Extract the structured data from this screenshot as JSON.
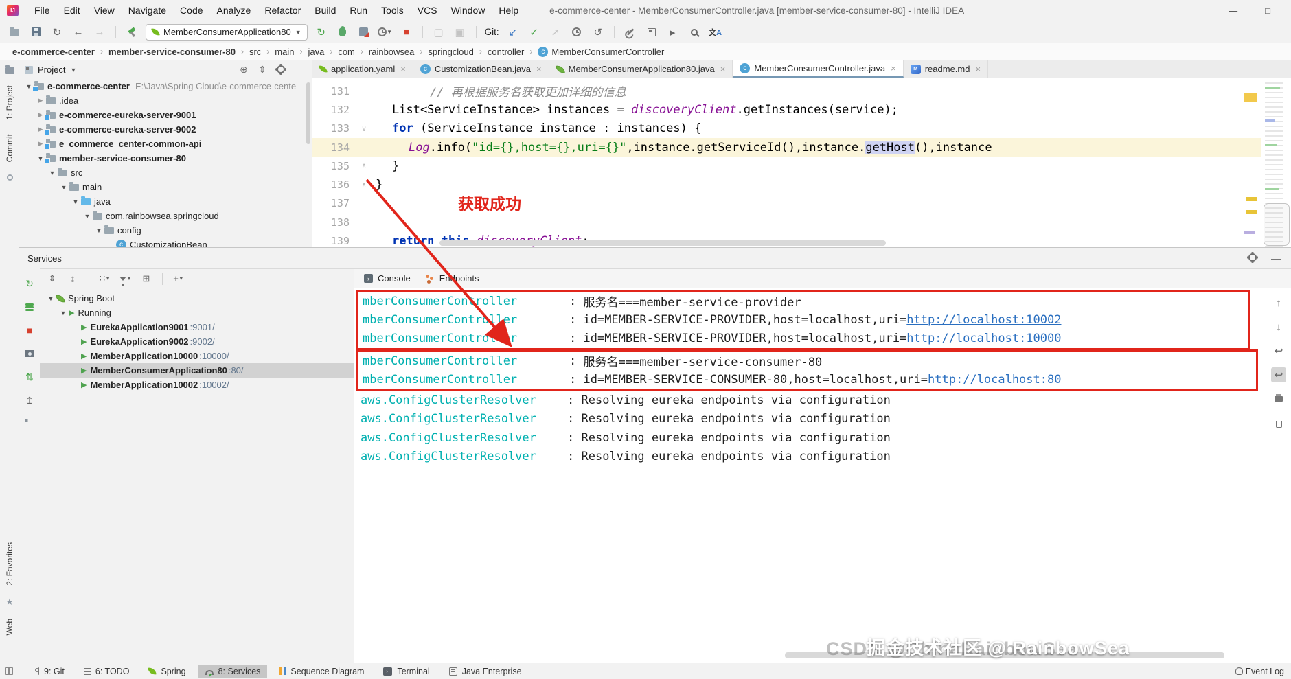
{
  "window": {
    "title": "e-commerce-center - MemberConsumerController.java [member-service-consumer-80] - IntelliJ IDEA",
    "minimize": "—",
    "maximize": "□",
    "logo": "IJ"
  },
  "menus": [
    "File",
    "Edit",
    "View",
    "Navigate",
    "Code",
    "Analyze",
    "Refactor",
    "Build",
    "Run",
    "Tools",
    "VCS",
    "Window",
    "Help"
  ],
  "toolbar": {
    "run_config": "MemberConsumerApplication80",
    "git_label": "Git:",
    "translate_cn": "文",
    "translate_en": "A"
  },
  "breadcrumbs": [
    {
      "label": "e-commerce-center",
      "bold": true
    },
    {
      "label": "member-service-consumer-80",
      "bold": true
    },
    {
      "label": "src"
    },
    {
      "label": "main"
    },
    {
      "label": "java"
    },
    {
      "label": "com"
    },
    {
      "label": "rainbowsea"
    },
    {
      "label": "springcloud"
    },
    {
      "label": "controller"
    },
    {
      "label": "MemberConsumerController",
      "icon": "class"
    }
  ],
  "left_stripe": {
    "top_items": [
      "1: Project",
      "Commit"
    ],
    "bottom_items": [
      "2: Favorites",
      "Web"
    ]
  },
  "project_panel": {
    "title": "Project",
    "tree": [
      {
        "label": "e-commerce-center",
        "path": "E:\\Java\\Spring Cloud\\e-commerce-cente",
        "indent": 0,
        "arrow": "exp",
        "icon": "module",
        "bold": true
      },
      {
        "label": ".idea",
        "indent": 1,
        "arrow": "col",
        "icon": "folder"
      },
      {
        "label": "e-commerce-eureka-server-9001",
        "indent": 1,
        "arrow": "col",
        "icon": "module",
        "bold": true
      },
      {
        "label": "e-commerce-eureka-server-9002",
        "indent": 1,
        "arrow": "col",
        "icon": "module",
        "bold": true
      },
      {
        "label": "e_commerce_center-common-api",
        "indent": 1,
        "arrow": "col",
        "icon": "module",
        "bold": true
      },
      {
        "label": "member-service-consumer-80",
        "indent": 1,
        "arrow": "exp",
        "icon": "module",
        "bold": true
      },
      {
        "label": "src",
        "indent": 2,
        "arrow": "exp",
        "icon": "folder"
      },
      {
        "label": "main",
        "indent": 3,
        "arrow": "exp",
        "icon": "folder"
      },
      {
        "label": "java",
        "indent": 4,
        "arrow": "exp",
        "icon": "folder-blue"
      },
      {
        "label": "com.rainbowsea.springcloud",
        "indent": 5,
        "arrow": "exp",
        "icon": "folder"
      },
      {
        "label": "config",
        "indent": 6,
        "arrow": "exp",
        "icon": "folder"
      },
      {
        "label": "CustomizationBean",
        "indent": 7,
        "arrow": "none",
        "icon": "class"
      }
    ]
  },
  "editor": {
    "tabs": [
      {
        "label": "application.yaml",
        "icon": "leaf",
        "close": "×"
      },
      {
        "label": "CustomizationBean.java",
        "icon": "class",
        "close": "×"
      },
      {
        "label": "MemberConsumerApplication80.java",
        "icon": "springboot",
        "close": "×"
      },
      {
        "label": "MemberConsumerController.java",
        "icon": "class",
        "close": "×",
        "active": true
      },
      {
        "label": "readme.md",
        "icon": "md",
        "close": "×"
      }
    ],
    "annotation": "获取成功",
    "lines": [
      {
        "num": "131",
        "indent": 79,
        "fold": "",
        "tokens": [
          [
            "cmt",
            "// 再根据服务名获取更加详细的信息"
          ]
        ]
      },
      {
        "num": "132",
        "indent": 24,
        "fold": "",
        "tokens": [
          [
            "pln",
            "List<ServiceInstance> instances = "
          ],
          [
            "fld",
            "discoveryClient"
          ],
          [
            "pln",
            ".getInstances(service);"
          ]
        ]
      },
      {
        "num": "133",
        "indent": 24,
        "fold": "down",
        "tokens": [
          [
            "kw",
            "for"
          ],
          [
            "pln",
            " (ServiceInstance instance : instances) {"
          ]
        ]
      },
      {
        "num": "134",
        "indent": 48,
        "fold": "",
        "highlight": true,
        "tokens": [
          [
            "fld",
            "Log"
          ],
          [
            "pln",
            ".info("
          ],
          [
            "str",
            "\"id={},host={},uri={}\""
          ],
          [
            "pln",
            ",instance.getServiceId(),instance."
          ],
          [
            "sel",
            "getHost"
          ],
          [
            "pln",
            "(),instance"
          ]
        ]
      },
      {
        "num": "135",
        "indent": 24,
        "fold": "up",
        "tokens": [
          [
            "pln",
            "}"
          ]
        ]
      },
      {
        "num": "136",
        "indent": 0,
        "fold": "up",
        "tokens": [
          [
            "pln",
            "}"
          ]
        ]
      },
      {
        "num": "137",
        "indent": 0,
        "fold": "",
        "tokens": []
      },
      {
        "num": "138",
        "indent": 0,
        "fold": "",
        "tokens": []
      },
      {
        "num": "139",
        "indent": 24,
        "fold": "",
        "tokens": [
          [
            "kw",
            "return"
          ],
          [
            "pln",
            " "
          ],
          [
            "kw",
            "this"
          ],
          [
            "pln",
            "."
          ],
          [
            "fld",
            "discoveryClient"
          ],
          [
            "pln",
            ";"
          ]
        ]
      }
    ]
  },
  "services": {
    "title": "Services",
    "tabs": [
      {
        "label": "Console",
        "icon": "console-tab"
      },
      {
        "label": "Endpoints",
        "icon": "endpoints"
      }
    ],
    "tree": [
      {
        "label": "Spring Boot",
        "indent": 0,
        "arrow": "exp",
        "icon": "springboot"
      },
      {
        "label": "Running",
        "indent": 1,
        "arrow": "exp",
        "icon": "play"
      },
      {
        "label": "EurekaApplication9001",
        "port": ":9001/",
        "indent": 2,
        "arrow": "col",
        "icon": "play",
        "bold": true
      },
      {
        "label": "EurekaApplication9002",
        "port": ":9002/",
        "indent": 2,
        "arrow": "col",
        "icon": "play",
        "bold": true
      },
      {
        "label": "MemberApplication10000",
        "port": ":10000/",
        "indent": 2,
        "arrow": "col",
        "icon": "play",
        "bold": true
      },
      {
        "label": "MemberConsumerApplication80",
        "port": ":80/",
        "indent": 2,
        "arrow": "col",
        "icon": "play",
        "bold": true,
        "selected": true
      },
      {
        "label": "MemberApplication10002",
        "port": ":10002/",
        "indent": 2,
        "arrow": "col",
        "icon": "play",
        "bold": true
      }
    ],
    "console_groups": [
      {
        "boxed": true,
        "lines": [
          {
            "logger": "mberConsumerController",
            "sep": ": ",
            "message": "服务名===member-service-provider"
          },
          {
            "logger": "mberConsumerController",
            "sep": ": ",
            "message": "id=MEMBER-SERVICE-PROVIDER,host=localhost,uri=",
            "link": "http://localhost:10002"
          },
          {
            "logger": "mberConsumerController",
            "sep": ": ",
            "message": "id=MEMBER-SERVICE-PROVIDER,host=localhost,uri=",
            "link": "http://localhost:10000"
          }
        ]
      },
      {
        "boxed": true,
        "lines": [
          {
            "logger": "mberConsumerController",
            "sep": ": ",
            "message": "服务名===member-service-consumer-80"
          },
          {
            "logger": "mberConsumerController",
            "sep": ": ",
            "message": "id=MEMBER-SERVICE-CONSUMER-80,host=localhost,uri=",
            "link": "http://localhost:80"
          }
        ]
      },
      {
        "boxed": false,
        "lines": [
          {
            "logger": "aws.ConfigClusterResolver",
            "sep": ": ",
            "message": "Resolving eureka endpoints via configuration"
          },
          {
            "logger": "aws.ConfigClusterResolver",
            "sep": ": ",
            "message": "Resolving eureka endpoints via configuration"
          },
          {
            "logger": "aws.ConfigClusterResolver",
            "sep": ": ",
            "message": "Resolving eureka endpoints via configuration"
          },
          {
            "logger": "aws.ConfigClusterResolver",
            "sep": ": ",
            "message": "Resolving eureka endpoints via configuration"
          }
        ]
      }
    ]
  },
  "status_bar": {
    "items": [
      {
        "label": "9: Git",
        "icon": "branch"
      },
      {
        "label": "6: TODO",
        "icon": "lines3"
      },
      {
        "label": "Spring",
        "icon": "leaf"
      },
      {
        "label": "8: Services",
        "icon": "gauge",
        "active": true
      },
      {
        "label": "Sequence Diagram",
        "icon": "seq"
      },
      {
        "label": "Terminal",
        "icon": "term"
      },
      {
        "label": "Java Enterprise",
        "icon": "jee"
      }
    ],
    "event_log": "Event Log"
  },
  "watermark": {
    "back": "CSDN @ChinaRainbowSea",
    "front": "掘金技术社区 @ RainbowSea"
  }
}
